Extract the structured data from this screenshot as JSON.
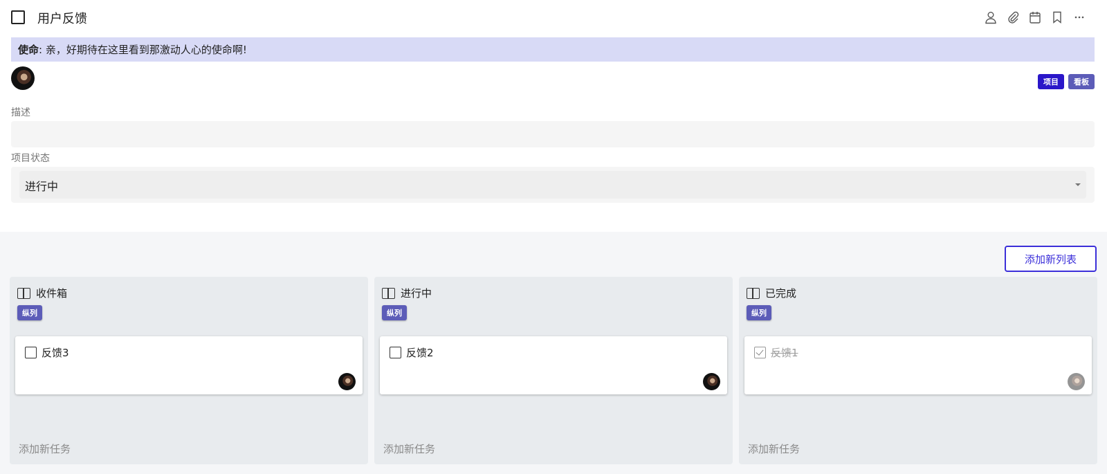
{
  "header": {
    "title": "用户反馈",
    "icons": [
      "person-icon",
      "paperclip-icon",
      "calendar-icon",
      "bookmark-icon",
      "more-icon"
    ]
  },
  "mission": {
    "label": "使命",
    "separator": ":",
    "text": "亲，好期待在这里看到那激动人心的使命啊!"
  },
  "tags": [
    {
      "label": "项目",
      "color": "#2a16c9"
    },
    {
      "label": "看板",
      "color": "#5c5cb8"
    }
  ],
  "form": {
    "description_label": "描述",
    "description_value": "",
    "status_label": "项目状态",
    "status_value": "进行中"
  },
  "board": {
    "add_list_label": "添加新列表",
    "columns": [
      {
        "title": "收件箱",
        "tag": "纵列",
        "card": {
          "title": "反馈3",
          "done": false
        },
        "add_task": "添加新任务"
      },
      {
        "title": "进行中",
        "tag": "纵列",
        "card": {
          "title": "反馈2",
          "done": false
        },
        "add_task": "添加新任务"
      },
      {
        "title": "已完成",
        "tag": "纵列",
        "card": {
          "title": "反馈1",
          "done": true
        },
        "add_task": "添加新任务"
      }
    ]
  },
  "colors": {
    "accent": "#3b2fd9",
    "mission_bg": "#d8daf6",
    "column_tag": "#5c5cb8"
  }
}
